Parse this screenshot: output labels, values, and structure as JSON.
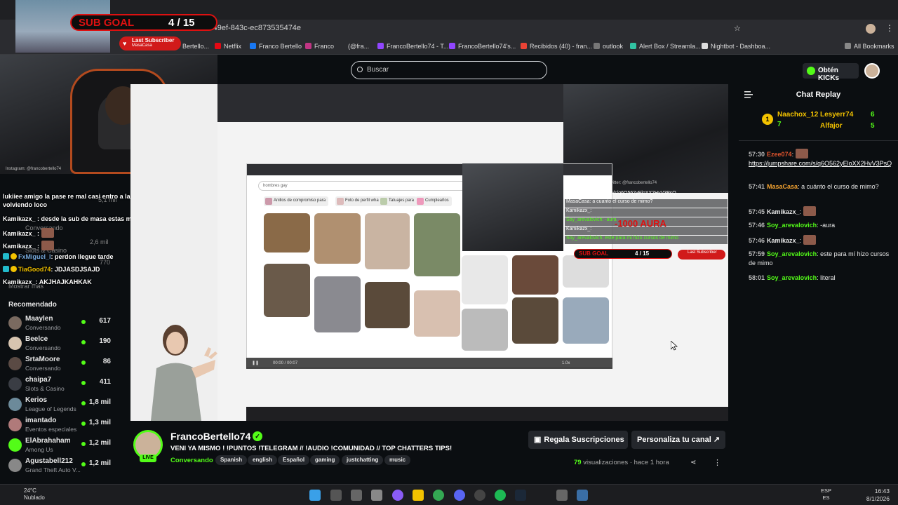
{
  "browser": {
    "url": "-49ef-843c-ec873535474e",
    "bookmarks": [
      "Bertello...",
      "Netflix",
      "Franco Bertello",
      "Franco",
      "(@fra...",
      "FrancoBertello74 - T...",
      "FrancoBertello74's...",
      "Recibidos (40) - fran...",
      "outlook",
      "Alert Box / Streamla...",
      "Nightbot - Dashboa..."
    ],
    "all_bookmarks": "All Bookmarks"
  },
  "overlay": {
    "sub_goal_label": "SUB GOAL",
    "sub_goal_count": "4 / 15",
    "last_subscriber_title": "Last Subscriber",
    "last_subscriber_name": "MasaCasa",
    "instagram": "Instagram: @francobertello74",
    "twitter": "Twitter: @francobertello74",
    "aura_text": "-1000 AURA",
    "nested_link": "https://jumpshare.com/s/q6O562yEloXX2HvV3PsQ",
    "nested_rows": [
      "MasaCasa: a cuanto el curso de mimo?",
      "Kamikazx_:",
      "Soy_arevalovich: -aura",
      "Kamikazx_:",
      "Soy_arevalovich: este para mi hizo cursos de mimo"
    ],
    "inner_search": "hombres gay",
    "chips": [
      "Anillos de compromiso para",
      "Foto de perfil whatsapp",
      "Tatuajes para",
      "Cumpleaños"
    ],
    "player_time": "00:00 / 00:07",
    "player_speed": "1.0x"
  },
  "overlay_chat": [
    {
      "user": "lukiiee",
      "text": "amigo la pase re mal casi entro a la bios nose me estaba volviendo loco"
    },
    {
      "user": "Kamikazx_",
      "text": ": desde la sub de masa estas mute"
    },
    {
      "user": "Kamikazx_",
      "text": ":"
    },
    {
      "user": "Kamikazx_",
      "text": ":"
    },
    {
      "user": "FxMiguel_l",
      "text": ": perdon llegue tarde"
    },
    {
      "user": "TiaGood74",
      "text": ": JDJASDJSAJD"
    },
    {
      "user": "Kamikazx_",
      "text": ": AKJHAJKAHKAK"
    }
  ],
  "sidebar_faded": [
    "Conversando",
    "5,1 mil",
    "2,6 mil",
    "Slots & Casino",
    "770",
    "Mostrar más"
  ],
  "sidebar": {
    "recommended_title": "Recomendado",
    "channels": [
      {
        "name": "Maaylen",
        "category": "Conversando",
        "viewers": "617",
        "color": "#7a6a60"
      },
      {
        "name": "Beelce",
        "category": "Conversando",
        "viewers": "190",
        "color": "#d8c5b0"
      },
      {
        "name": "SrtaMoore",
        "category": "Conversando",
        "viewers": "86",
        "color": "#5a4a44"
      },
      {
        "name": "chaipa7",
        "category": "Slots & Casino",
        "viewers": "411",
        "color": "#3a3d44"
      },
      {
        "name": "Kerios",
        "category": "League of Legends",
        "viewers": "1,8 mil",
        "color": "#6c8a9a"
      },
      {
        "name": "imantado",
        "category": "Eventos especiales",
        "viewers": "1,3 mil",
        "color": "#b07a7a"
      },
      {
        "name": "ElAbrahaham",
        "category": "Among Us",
        "viewers": "1,2 mil",
        "color": "#53fc18"
      },
      {
        "name": "Agustabell212",
        "category": "Grand Theft Auto V...",
        "viewers": "1,2 mil",
        "color": "#888"
      }
    ]
  },
  "header": {
    "search_placeholder": "Buscar",
    "kicks_button": "Obtén KICKs"
  },
  "chat": {
    "title": "Chat Replay",
    "top_chatters": [
      {
        "name": "Naachox_12",
        "count": "7"
      },
      {
        "name": "Lesyerr74",
        "count": "6"
      },
      {
        "name": "Alfajor",
        "count": "5"
      }
    ],
    "messages": [
      {
        "time": "57:30",
        "user": "Ezee074",
        "color": "#e0542d",
        "text": ":",
        "link": "https://jumpshare.com/s/q6O562yEloXX2HvV3PsQ"
      },
      {
        "time": "57:41",
        "user": "MasaCasa",
        "color": "#f0a030",
        "text": ": a cuánto el curso de mimo?"
      },
      {
        "time": "57:45",
        "user": "Kamikazx_",
        "color": "#e8e8e8",
        "text": ":"
      },
      {
        "time": "57:46",
        "user": "Soy_arevalovich",
        "color": "#53fc18",
        "text": ": -aura"
      },
      {
        "time": "57:46",
        "user": "Kamikazx_",
        "color": "#e8e8e8",
        "text": ":"
      },
      {
        "time": "57:59",
        "user": "Soy_arevalovich",
        "color": "#53fc18",
        "text": ": este para mí hizo cursos de mimo"
      },
      {
        "time": "58:01",
        "user": "Soy_arevalovich",
        "color": "#53fc18",
        "text": ": literal"
      }
    ]
  },
  "stream": {
    "live_badge": "LIVE",
    "name": "FrancoBertello74",
    "title": "VENI YA MISMO ! !PUNTOS !TELEGRAM // !AUDIO !COMUNIDAD // TOP CHATTERS TIPS!",
    "category": "Conversando",
    "tags": [
      "Spanish",
      "english",
      "Español",
      "gaming",
      "justchatting",
      "music"
    ],
    "gift_button": "Regala Suscripciones",
    "customize_button": "Personaliza tu canal",
    "views_count": "79",
    "views_label": "visualizaciones",
    "time_ago": "hace 1 hora"
  },
  "taskbar": {
    "temp": "24°C",
    "weather": "Nublado",
    "lang1": "ESP",
    "lang2": "ES",
    "time": "16:43",
    "date": "8/1/2026"
  },
  "colors": {
    "kick_green": "#53fc18",
    "red": "#d11a1a",
    "bg": "#0b0e11"
  }
}
